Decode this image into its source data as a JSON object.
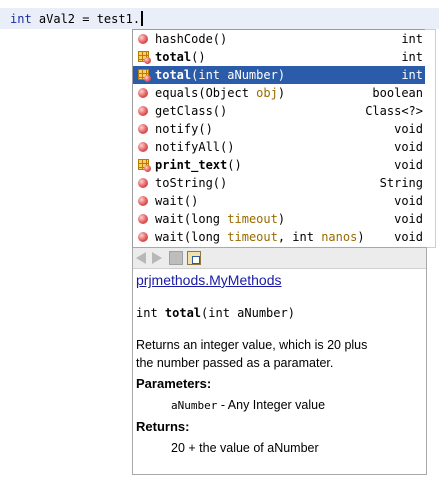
{
  "editor": {
    "keyword": "int",
    "code": " aVal2 = test1."
  },
  "completion": {
    "items": [
      {
        "name": "hashCode",
        "params": "()",
        "type": "int",
        "icon": "method-icon",
        "bold": false
      },
      {
        "name": "total",
        "params": "()",
        "type": "int",
        "icon": "class-method-icon",
        "bold": true
      },
      {
        "name": "total",
        "params": "(int aNumber)",
        "type": "int",
        "icon": "class-method-icon",
        "bold": true,
        "selected": true
      },
      {
        "name": "equals",
        "paramPre": "(Object ",
        "paramName": "obj",
        "paramPost": ")",
        "type": "boolean",
        "icon": "method-icon"
      },
      {
        "name": "getClass",
        "params": "()",
        "type": "Class<?>",
        "icon": "method-icon"
      },
      {
        "name": "notify",
        "params": "()",
        "type": "void",
        "icon": "method-icon"
      },
      {
        "name": "notifyAll",
        "params": "()",
        "type": "void",
        "icon": "method-icon"
      },
      {
        "name": "print_text",
        "params": "()",
        "type": "void",
        "icon": "class-method-icon",
        "bold": true
      },
      {
        "name": "toString",
        "params": "()",
        "type": "String",
        "icon": "method-icon"
      },
      {
        "name": "wait",
        "params": "()",
        "type": "void",
        "icon": "method-icon"
      },
      {
        "name": "wait",
        "paramPre": "(long ",
        "paramName": "timeout",
        "paramPost": ")",
        "type": "void",
        "icon": "method-icon"
      },
      {
        "name": "wait",
        "paramPre": "(long ",
        "paramName": "timeout",
        "paramMid": ", int ",
        "paramName2": "nanos",
        "paramPost": ")",
        "type": "void",
        "icon": "method-icon"
      }
    ]
  },
  "javadoc": {
    "class_link": "prjmethods.MyMethods",
    "sig_pre": "int ",
    "sig_name": "total",
    "sig_post": "(int aNumber)",
    "description_line1": "Returns an integer value, which is 20 plus",
    "description_line2": "the number passed as a paramater.",
    "params_heading": "Parameters:",
    "param_name": "aNumber",
    "param_desc": " - Any Integer value",
    "returns_heading": "Returns:",
    "returns_desc": "20 + the value of aNumber"
  },
  "colors": {
    "selection": "#2a5caa",
    "keyword": "#1d2ca5",
    "param_name": "#9a6a00",
    "link": "#1a1aa6"
  }
}
